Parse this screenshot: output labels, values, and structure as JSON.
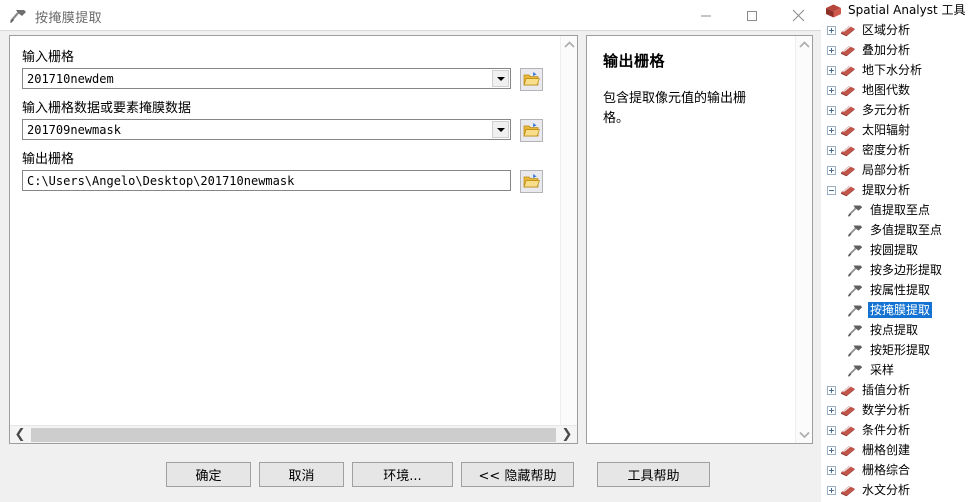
{
  "window": {
    "title": "按掩膜提取",
    "title_icon": "hammer-tool-icon",
    "minimize_label": "—",
    "maximize_label": "□",
    "close_label": "✕"
  },
  "form": {
    "fields": [
      {
        "label": "输入栅格",
        "value": "201710newdem",
        "type": "combobox",
        "browse_icon": "open-folder-icon"
      },
      {
        "label": "输入栅格数据或要素掩膜数据",
        "value": "201709newmask",
        "type": "combobox",
        "browse_icon": "open-folder-icon"
      },
      {
        "label": "输出栅格",
        "value": "C:\\Users\\Angelo\\Desktop\\201710newmask",
        "type": "textbox",
        "browse_icon": "open-folder-icon"
      }
    ],
    "scroll_up_icon": "chevron-up-icon",
    "scroll_down_icon": "chevron-down-icon",
    "scroll_left_icon": "❮",
    "scroll_right_icon": "❯"
  },
  "help": {
    "title": "输出栅格",
    "body": "包含提取像元值的输出栅格。",
    "scroll_up_icon": "chevron-up-icon",
    "scroll_down_icon": "chevron-down-icon"
  },
  "buttons": {
    "ok": "确定",
    "cancel": "取消",
    "environments": "环境...",
    "hide_help": "<< 隐藏帮助",
    "tool_help": "工具帮助"
  },
  "toolbox": {
    "root": {
      "label": "Spatial Analyst 工具",
      "icon": "toolbox-icon"
    },
    "items": [
      {
        "label": "区域分析",
        "icon": "toolset-icon",
        "state": "collapsed",
        "level": 1
      },
      {
        "label": "叠加分析",
        "icon": "toolset-icon",
        "state": "collapsed",
        "level": 1
      },
      {
        "label": "地下水分析",
        "icon": "toolset-icon",
        "state": "collapsed",
        "level": 1
      },
      {
        "label": "地图代数",
        "icon": "toolset-icon",
        "state": "collapsed",
        "level": 1
      },
      {
        "label": "多元分析",
        "icon": "toolset-icon",
        "state": "collapsed",
        "level": 1
      },
      {
        "label": "太阳辐射",
        "icon": "toolset-icon",
        "state": "collapsed",
        "level": 1
      },
      {
        "label": "密度分析",
        "icon": "toolset-icon",
        "state": "collapsed",
        "level": 1
      },
      {
        "label": "局部分析",
        "icon": "toolset-icon",
        "state": "collapsed",
        "level": 1
      },
      {
        "label": "提取分析",
        "icon": "toolset-icon",
        "state": "expanded",
        "level": 1
      },
      {
        "label": "值提取至点",
        "icon": "hammer-tool-icon",
        "state": "leaf",
        "level": 2
      },
      {
        "label": "多值提取至点",
        "icon": "hammer-tool-icon",
        "state": "leaf",
        "level": 2
      },
      {
        "label": "按圆提取",
        "icon": "hammer-tool-icon",
        "state": "leaf",
        "level": 2
      },
      {
        "label": "按多边形提取",
        "icon": "hammer-tool-icon",
        "state": "leaf",
        "level": 2
      },
      {
        "label": "按属性提取",
        "icon": "hammer-tool-icon",
        "state": "leaf",
        "level": 2
      },
      {
        "label": "按掩膜提取",
        "icon": "hammer-tool-icon",
        "state": "leaf",
        "level": 2,
        "selected": true
      },
      {
        "label": "按点提取",
        "icon": "hammer-tool-icon",
        "state": "leaf",
        "level": 2
      },
      {
        "label": "按矩形提取",
        "icon": "hammer-tool-icon",
        "state": "leaf",
        "level": 2
      },
      {
        "label": "采样",
        "icon": "hammer-tool-icon",
        "state": "leaf",
        "level": 2
      },
      {
        "label": "插值分析",
        "icon": "toolset-icon",
        "state": "collapsed",
        "level": 1
      },
      {
        "label": "数学分析",
        "icon": "toolset-icon",
        "state": "collapsed",
        "level": 1
      },
      {
        "label": "条件分析",
        "icon": "toolset-icon",
        "state": "collapsed",
        "level": 1
      },
      {
        "label": "栅格创建",
        "icon": "toolset-icon",
        "state": "collapsed",
        "level": 1
      },
      {
        "label": "栅格综合",
        "icon": "toolset-icon",
        "state": "collapsed",
        "level": 1
      },
      {
        "label": "水文分析",
        "icon": "toolset-icon",
        "state": "collapsed",
        "level": 1
      }
    ]
  },
  "colors": {
    "selection": "#1473d2",
    "dialog_bg": "#f0f0f0",
    "panel_bg": "#ffffff",
    "folder": "#f5c842"
  }
}
